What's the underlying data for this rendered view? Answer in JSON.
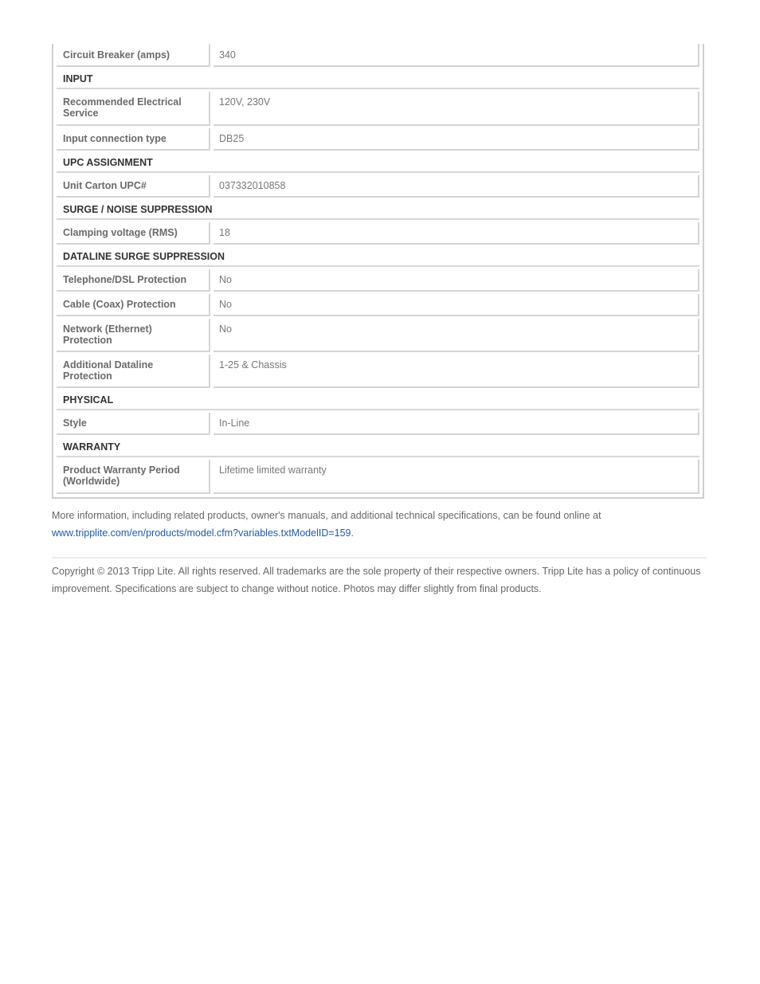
{
  "spec_table": {
    "rows": [
      {
        "type": "row",
        "label": "Circuit Breaker (amps)",
        "value": "340"
      },
      {
        "type": "section",
        "label": "INPUT"
      },
      {
        "type": "row",
        "label": "Recommended Electrical Service",
        "value": "120V, 230V"
      },
      {
        "type": "row",
        "label": "Input connection type",
        "value": "DB25"
      },
      {
        "type": "section",
        "label": "UPC ASSIGNMENT"
      },
      {
        "type": "row",
        "label": "Unit Carton UPC#",
        "value": "037332010858"
      },
      {
        "type": "section",
        "label": "SURGE / NOISE SUPPRESSION"
      },
      {
        "type": "row",
        "label": "Clamping voltage (RMS)",
        "value": "18"
      },
      {
        "type": "section",
        "label": "DATALINE SURGE SUPPRESSION"
      },
      {
        "type": "row",
        "label": "Telephone/DSL Protection",
        "value": "No"
      },
      {
        "type": "row",
        "label": "Cable (Coax) Protection",
        "value": "No"
      },
      {
        "type": "row",
        "label": "Network (Ethernet) Protection",
        "value": "No"
      },
      {
        "type": "row",
        "label": "Additional Dataline Protection",
        "value": "1-25 & Chassis"
      },
      {
        "type": "section",
        "label": "PHYSICAL"
      },
      {
        "type": "row",
        "label": "Style",
        "value": "In-Line"
      },
      {
        "type": "section",
        "label": "WARRANTY"
      },
      {
        "type": "row",
        "label": "Product Warranty Period (Worldwide)",
        "value": "Lifetime limited warranty"
      }
    ]
  },
  "more_info": {
    "text": "More information, including related products, owner's manuals, and additional technical specifications, can be found online at",
    "link": "www.tripplite.com/en/products/model.cfm?variables.txtModelID=159",
    "trailing": "."
  },
  "copyright": {
    "text": "Copyright © 2013 Tripp Lite. All rights reserved. All trademarks are the sole property of their respective owners. Tripp Lite has a policy of continuous improvement. Specifications are subject to change without notice. Photos may differ slightly from final products."
  }
}
